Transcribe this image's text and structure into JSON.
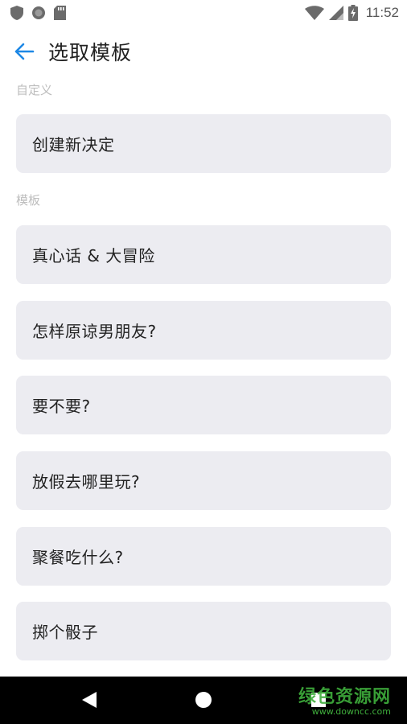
{
  "status_bar": {
    "time": "11:52",
    "left_icons": [
      "shield-icon",
      "circle-icon",
      "sd-card-icon"
    ],
    "right_icons": [
      "wifi-icon",
      "signal-icon",
      "battery-charging-icon"
    ]
  },
  "app_bar": {
    "back_icon": "arrow-left-icon",
    "title": "选取模板",
    "accent_color": "#1e88e5"
  },
  "sections": {
    "custom_label": "自定义",
    "templates_label": "模板"
  },
  "custom_items": [
    {
      "label": "创建新决定"
    }
  ],
  "template_items": [
    {
      "label": "真心话 & 大冒险"
    },
    {
      "label": "怎样原谅男朋友?"
    },
    {
      "label": "要不要?"
    },
    {
      "label": "放假去哪里玩?"
    },
    {
      "label": "聚餐吃什么?"
    },
    {
      "label": "掷个骰子"
    }
  ],
  "nav_bar": {
    "icons": [
      "back-triangle-icon",
      "home-circle-icon",
      "recents-square-icon"
    ]
  },
  "watermark": {
    "main": "绿色资源网",
    "sub": "www.downcc.com"
  }
}
